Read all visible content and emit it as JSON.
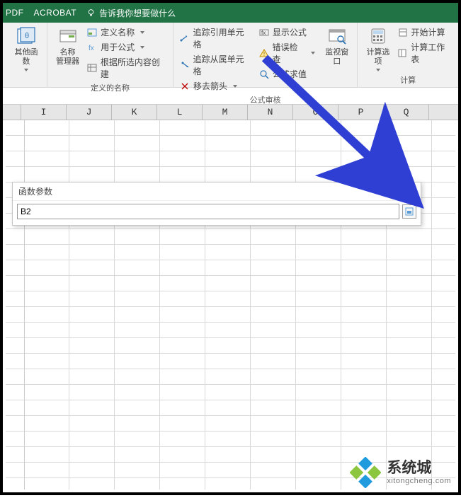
{
  "header": {
    "tabs": [
      "PDF",
      "ACROBAT"
    ],
    "tell_me": "告诉我你想要做什么"
  },
  "ribbon": {
    "group_func_lib": {
      "other_functions": "其他函数"
    },
    "group_defined_names": {
      "title": "定义的名称",
      "name_manager": "名称\n管理器",
      "define_name": "定义名称",
      "use_in_formula": "用于公式",
      "create_from_selection": "根据所选内容创建"
    },
    "group_formula_audit": {
      "title": "公式审核",
      "trace_precedents": "追踪引用单元格",
      "trace_dependents": "追踪从属单元格",
      "remove_arrows": "移去箭头",
      "show_formulas": "显示公式",
      "error_checking": "错误检查",
      "evaluate_formula": "公式求值",
      "watch_window": "监视窗口"
    },
    "group_calc": {
      "title": "计算",
      "calc_options": "计算选项",
      "calc_now": "开始计算",
      "calc_sheet": "计算工作表"
    }
  },
  "columns": [
    "I",
    "J",
    "K",
    "L",
    "M",
    "N",
    "O",
    "P",
    "Q"
  ],
  "dialog": {
    "title": "函数参数",
    "value": "B2"
  },
  "watermark": {
    "brand": "系统城",
    "url": "xitongcheng.com"
  }
}
